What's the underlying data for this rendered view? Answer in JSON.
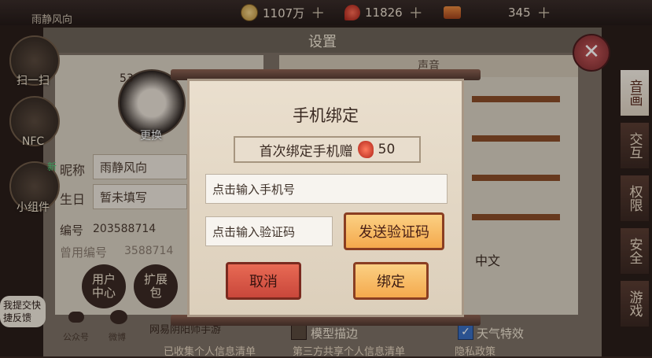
{
  "topbar": {
    "player_name": "雨静风向",
    "gold": "1107万",
    "jade": "11826",
    "tickets": "345"
  },
  "left_menu": [
    {
      "label": "扫一扫",
      "icon": "scan-icon"
    },
    {
      "label": "NFC",
      "icon": "nfc-icon"
    },
    {
      "label": "小组件",
      "icon": "widget-icon",
      "badge": "新"
    }
  ],
  "settings": {
    "title": "设置",
    "level": "53",
    "change_avatar": "更换",
    "nickname_label": "昵称",
    "nickname_value": "雨静风向",
    "birthday_label": "生日",
    "birthday_value": "暂未填写",
    "id_label": "编号",
    "id_value": "203588714",
    "old_id_label": "曾用编号",
    "old_id_value": "3588714",
    "user_center": "用户中心",
    "expansion": "扩展包",
    "official_account": "公众号",
    "weibo": "微博",
    "feedback": "我提交快捷反馈",
    "footer_left": "网易阴阳师手游",
    "sound_header": "声音",
    "language_value": "中文",
    "model_outline": "模型描边",
    "weather_effect": "天气特效",
    "footer_links": [
      "已收集个人信息清单",
      "第三方共享个人信息清单",
      "隐私政策"
    ]
  },
  "right_tabs": [
    {
      "label": "音画",
      "active": true
    },
    {
      "label": "交互",
      "active": false
    },
    {
      "label": "权限",
      "active": false
    },
    {
      "label": "安全",
      "active": false
    },
    {
      "label": "游戏",
      "active": false
    }
  ],
  "dialog": {
    "title": "手机绑定",
    "reward_text": "首次绑定手机赠",
    "reward_amount": "50",
    "phone_placeholder": "点击输入手机号",
    "code_placeholder": "点击输入验证码",
    "send_code": "发送验证码",
    "cancel": "取消",
    "bind": "绑定"
  }
}
